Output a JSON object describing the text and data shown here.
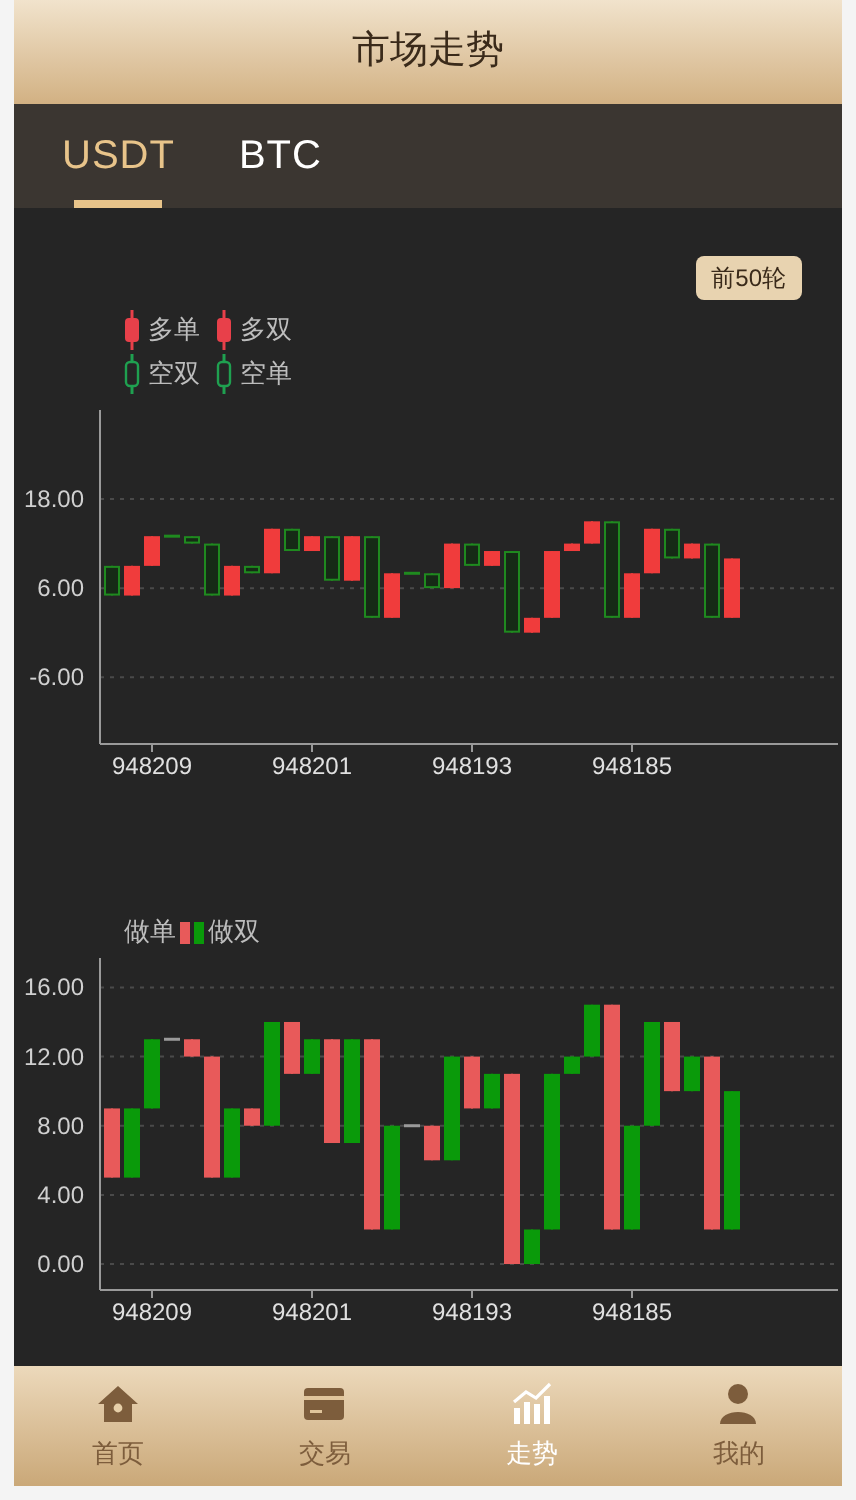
{
  "header": {
    "title": "市场走势"
  },
  "tabs": [
    {
      "label": "USDT",
      "selected": true
    },
    {
      "label": "BTC",
      "selected": false
    }
  ],
  "range_button": "前50轮",
  "candle_legend": [
    {
      "label": "多单",
      "color": "#e8404a",
      "kind": "filled"
    },
    {
      "label": "多双",
      "color": "#e8404a",
      "kind": "filled"
    },
    {
      "label": "空双",
      "color": "#1fa050",
      "kind": "hollow"
    },
    {
      "label": "空单",
      "color": "#1fa050",
      "kind": "hollow"
    }
  ],
  "candle_chart": {
    "chart_data": {
      "type": "candlestick",
      "grid": true,
      "categories": [
        null,
        null,
        "948209",
        null,
        null,
        null,
        null,
        null,
        null,
        null,
        "948201",
        null,
        null,
        null,
        null,
        null,
        null,
        null,
        "948193",
        null,
        null,
        null,
        null,
        null,
        null,
        null,
        "948185",
        null,
        null,
        null,
        null,
        null
      ],
      "ylim": [
        -15,
        30
      ],
      "yticks": [
        {
          "value": 18,
          "label": "18.00"
        },
        {
          "value": 6,
          "label": "6.00"
        },
        {
          "value": -6,
          "label": "-6.00"
        }
      ],
      "series": [
        {
          "color": "#f03c3c",
          "ohlc": [
            null,
            [
              5,
              9,
              5,
              9
            ],
            [
              9,
              13,
              9,
              13
            ],
            null,
            null,
            null,
            [
              5,
              9,
              5,
              9
            ],
            null,
            [
              8,
              14,
              8,
              14
            ],
            null,
            [
              11,
              13,
              11,
              13
            ],
            null,
            [
              7,
              13,
              7,
              13
            ],
            null,
            [
              2,
              8,
              2,
              8
            ],
            null,
            null,
            [
              6,
              12,
              6,
              12
            ],
            null,
            [
              9,
              11,
              9,
              11
            ],
            null,
            [
              0,
              2,
              0,
              2
            ],
            [
              2,
              11,
              2,
              11
            ],
            [
              11,
              12,
              11,
              12
            ],
            [
              12,
              15,
              12,
              15
            ],
            null,
            [
              2,
              8,
              2,
              8
            ],
            [
              8,
              14,
              8,
              14
            ],
            null,
            [
              10,
              12,
              10,
              12
            ],
            null,
            [
              2,
              10,
              2,
              10
            ]
          ]
        },
        {
          "color": "#1f8a1f",
          "ohlc": [
            [
              9,
              9,
              5,
              5
            ],
            null,
            null,
            [
              13,
              13,
              13,
              13
            ],
            [
              13,
              13,
              12,
              12
            ],
            [
              12,
              12,
              5,
              5
            ],
            null,
            [
              9,
              9,
              8,
              8
            ],
            null,
            [
              14,
              14,
              11,
              11
            ],
            null,
            [
              13,
              13,
              7,
              7
            ],
            null,
            [
              13,
              13,
              2,
              2
            ],
            null,
            [
              8,
              8,
              8,
              8
            ],
            [
              8,
              8,
              6,
              6
            ],
            null,
            [
              12,
              12,
              9,
              9
            ],
            null,
            [
              11,
              11,
              0,
              0
            ],
            null,
            null,
            null,
            null,
            [
              15,
              15,
              2,
              2
            ],
            null,
            null,
            [
              14,
              14,
              10,
              10
            ],
            null,
            [
              12,
              12,
              2,
              2
            ],
            null
          ]
        }
      ]
    }
  },
  "bar_chart": {
    "chart_data": {
      "type": "candlestick",
      "grid": true,
      "categories": [
        null,
        null,
        "948209",
        null,
        null,
        null,
        null,
        null,
        null,
        null,
        "948201",
        null,
        null,
        null,
        null,
        null,
        null,
        null,
        "948193",
        null,
        null,
        null,
        null,
        null,
        null,
        null,
        "948185",
        null,
        null,
        null,
        null,
        null
      ],
      "ylim": [
        -1.5,
        17.7
      ],
      "yticks": [
        {
          "value": 16,
          "label": "16.00"
        },
        {
          "value": 12,
          "label": "12.00"
        },
        {
          "value": 8,
          "label": "8.00"
        },
        {
          "value": 4,
          "label": "4.00"
        },
        {
          "value": 0,
          "label": "0.00"
        }
      ],
      "series": [
        {
          "name": "做单",
          "color": "#e85a5a",
          "ohlc": [
            [
              5,
              9,
              5,
              9
            ],
            null,
            null,
            null,
            [
              12,
              13,
              12,
              13
            ],
            [
              5,
              12,
              5,
              12
            ],
            null,
            [
              8,
              9,
              8,
              9
            ],
            null,
            [
              11,
              14,
              11,
              14
            ],
            null,
            [
              7,
              13,
              7,
              13
            ],
            null,
            [
              2,
              13,
              2,
              13
            ],
            null,
            null,
            [
              6,
              8,
              6,
              8
            ],
            null,
            [
              9,
              12,
              9,
              12
            ],
            null,
            [
              0,
              11,
              0,
              11
            ],
            null,
            null,
            null,
            null,
            [
              2,
              15,
              2,
              15
            ],
            null,
            null,
            [
              10,
              14,
              10,
              14
            ],
            null,
            [
              2,
              12,
              2,
              12
            ],
            null
          ]
        },
        {
          "name": "做双",
          "color": "#0a9a0a",
          "ohlc": [
            null,
            [
              5,
              9,
              5,
              9
            ],
            [
              9,
              13,
              9,
              13
            ],
            null,
            null,
            null,
            [
              5,
              9,
              5,
              9
            ],
            null,
            [
              8,
              14,
              8,
              14
            ],
            null,
            [
              11,
              13,
              11,
              13
            ],
            null,
            [
              7,
              13,
              7,
              13
            ],
            null,
            [
              2,
              8,
              2,
              8
            ],
            null,
            null,
            [
              6,
              12,
              6,
              12
            ],
            null,
            [
              9,
              11,
              9,
              11
            ],
            null,
            [
              0,
              2,
              0,
              2
            ],
            [
              2,
              11,
              2,
              11
            ],
            [
              11,
              12,
              11,
              12
            ],
            [
              12,
              15,
              12,
              15
            ],
            null,
            [
              2,
              8,
              2,
              8
            ],
            [
              8,
              14,
              8,
              14
            ],
            null,
            [
              10,
              12,
              10,
              12
            ],
            null,
            [
              2,
              10,
              2,
              10
            ]
          ]
        },
        {
          "color": "#9a9a9a",
          "ohlc": [
            null,
            null,
            null,
            [
              13,
              13,
              13,
              13
            ],
            null,
            null,
            null,
            null,
            null,
            null,
            null,
            null,
            null,
            null,
            null,
            [
              8,
              8,
              8,
              8
            ],
            null,
            null,
            null,
            null,
            null,
            null,
            null,
            null,
            null,
            null,
            null,
            null,
            null,
            null,
            null,
            null
          ]
        }
      ]
    }
  },
  "nav": [
    {
      "label": "首页",
      "selected": false
    },
    {
      "label": "交易",
      "selected": false
    },
    {
      "label": "走势",
      "selected": true
    },
    {
      "label": "我的",
      "selected": false
    }
  ]
}
